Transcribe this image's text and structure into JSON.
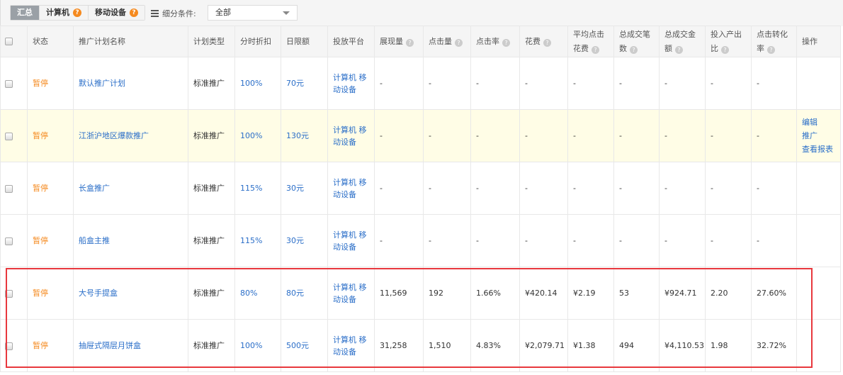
{
  "toolbar": {
    "tabs": [
      {
        "label": "汇总",
        "active": true,
        "help": false
      },
      {
        "label": "计算机",
        "active": false,
        "help": true
      },
      {
        "label": "移动设备",
        "active": false,
        "help": true
      }
    ],
    "help_glyph": "?",
    "filter_label": "细分条件:",
    "filter_value": "全部"
  },
  "table": {
    "headers": [
      {
        "key": "status",
        "label": "状态",
        "help": false
      },
      {
        "key": "name",
        "label": "推广计划名称",
        "help": false
      },
      {
        "key": "type",
        "label": "计划类型",
        "help": false
      },
      {
        "key": "discount",
        "label": "分时折扣",
        "help": false
      },
      {
        "key": "budget",
        "label": "日限额",
        "help": false
      },
      {
        "key": "platform",
        "label": "投放平台",
        "help": false
      },
      {
        "key": "impressions",
        "label": "展现量",
        "help": true
      },
      {
        "key": "clicks",
        "label": "点击量",
        "help": true
      },
      {
        "key": "ctr",
        "label": "点击率",
        "help": true
      },
      {
        "key": "cost",
        "label": "花费",
        "help": true
      },
      {
        "key": "cpc",
        "label": "平均点击花费",
        "help": true
      },
      {
        "key": "orders",
        "label": "总成交笔数",
        "help": true
      },
      {
        "key": "gmv",
        "label": "总成交金额",
        "help": true
      },
      {
        "key": "roi",
        "label": "投入产出比",
        "help": true
      },
      {
        "key": "cvr",
        "label": "点击转化率",
        "help": true
      },
      {
        "key": "ops",
        "label": "操作",
        "help": false
      }
    ],
    "rows": [
      {
        "status": "暂停",
        "name": "默认推广计划",
        "type": "标准推广",
        "discount": "100%",
        "budget": "70元",
        "platform": "计算机 移动设备",
        "impressions": "-",
        "clicks": "-",
        "ctr": "-",
        "cost": "-",
        "cpc": "-",
        "orders": "-",
        "gmv": "-",
        "roi": "-",
        "cvr": "-",
        "highlight": false,
        "ops": []
      },
      {
        "status": "暂停",
        "name": "江浙沪地区爆款推广",
        "type": "标准推广",
        "discount": "100%",
        "budget": "130元",
        "platform": "计算机 移动设备",
        "impressions": "-",
        "clicks": "-",
        "ctr": "-",
        "cost": "-",
        "cpc": "-",
        "orders": "-",
        "gmv": "-",
        "roi": "-",
        "cvr": "-",
        "highlight": true,
        "ops": [
          "编辑",
          "推广",
          "查看报表"
        ]
      },
      {
        "status": "暂停",
        "name": "长盒推广",
        "type": "标准推广",
        "discount": "115%",
        "budget": "30元",
        "platform": "计算机 移动设备",
        "impressions": "-",
        "clicks": "-",
        "ctr": "-",
        "cost": "-",
        "cpc": "-",
        "orders": "-",
        "gmv": "-",
        "roi": "-",
        "cvr": "-",
        "highlight": false,
        "ops": []
      },
      {
        "status": "暂停",
        "name": "船盒主推",
        "type": "标准推广",
        "discount": "115%",
        "budget": "30元",
        "platform": "计算机 移动设备",
        "impressions": "-",
        "clicks": "-",
        "ctr": "-",
        "cost": "-",
        "cpc": "-",
        "orders": "-",
        "gmv": "-",
        "roi": "-",
        "cvr": "-",
        "highlight": false,
        "ops": []
      },
      {
        "status": "暂停",
        "name": "大号手提盒",
        "type": "标准推广",
        "discount": "80%",
        "budget": "80元",
        "platform": "计算机 移动设备",
        "impressions": "11,569",
        "clicks": "192",
        "ctr": "1.66%",
        "cost": "¥420.14",
        "cpc": "¥2.19",
        "orders": "53",
        "gmv": "¥924.71",
        "roi": "2.20",
        "cvr": "27.60%",
        "highlight": false,
        "ops": []
      },
      {
        "status": "暂停",
        "name": "抽屉式隔层月饼盒",
        "type": "标准推广",
        "discount": "100%",
        "budget": "500元",
        "platform": "计算机 移动设备",
        "impressions": "31,258",
        "clicks": "1,510",
        "ctr": "4.83%",
        "cost": "¥2,079.71",
        "cpc": "¥1.38",
        "orders": "494",
        "gmv": "¥4,110.53",
        "roi": "1.98",
        "cvr": "32.72%",
        "highlight": false,
        "ops": []
      }
    ]
  },
  "annotation": {
    "label": "highlighted-rows",
    "color": "#e8383d"
  },
  "colors": {
    "status": "#f58a1f",
    "link": "#2a6ec8",
    "highlight_row": "#fffde6",
    "help_badge": "#f58a1f"
  }
}
